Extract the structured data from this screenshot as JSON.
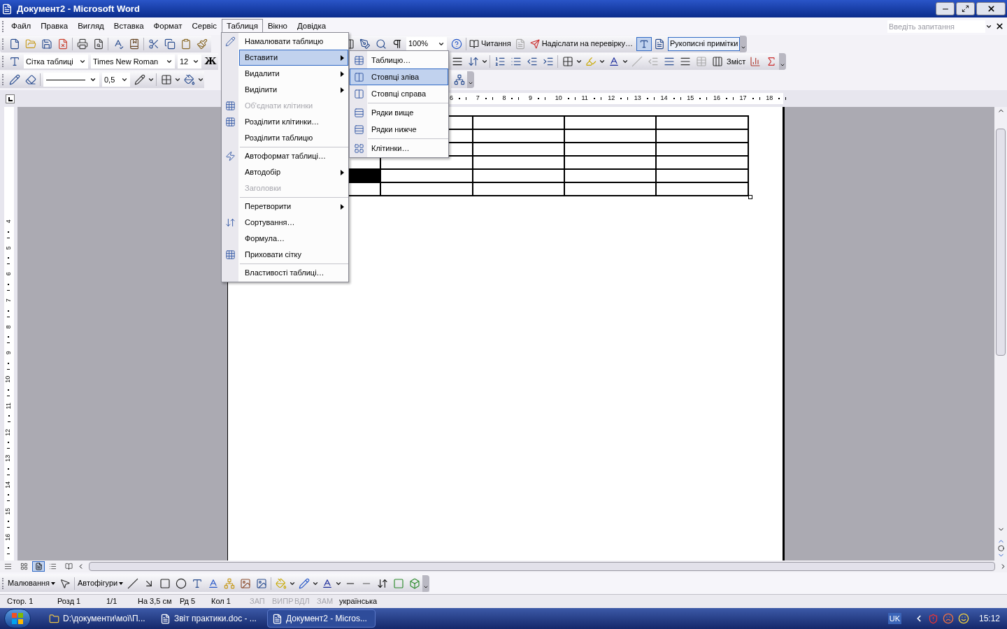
{
  "window": {
    "title": "Документ2 - Microsoft Word"
  },
  "menu_bar": [
    {
      "label": "Файл",
      "selected": false
    },
    {
      "label": "Правка",
      "selected": false
    },
    {
      "label": "Вигляд",
      "selected": false
    },
    {
      "label": "Вставка",
      "selected": false
    },
    {
      "label": "Формат",
      "selected": false
    },
    {
      "label": "Сервіс",
      "selected": false
    },
    {
      "label": "Таблиця",
      "selected": true
    },
    {
      "label": "Вікно",
      "selected": false
    },
    {
      "label": "Довідка",
      "selected": false
    }
  ],
  "help_search": {
    "placeholder": "Введіть запитання"
  },
  "standard_toolbar": {
    "zoom": "100%",
    "reading": "Читання",
    "send_review": "Надіслати на перевірку…",
    "ink_annotations": "Рукописні примітки"
  },
  "formatting_toolbar": {
    "style": "Сітка таблиці",
    "font": "Times New Roman",
    "size": "12",
    "bold": "Ж",
    "toc": "Зміст"
  },
  "tables_toolbar": {
    "line_weight": "0,5"
  },
  "horizontal_ruler": [
    "6",
    "7",
    "8",
    "9",
    "10",
    "11",
    "12",
    "13",
    "14",
    "15",
    "16",
    "17",
    "18"
  ],
  "vertical_ruler": [
    "4",
    "5",
    "6",
    "7",
    "8",
    "9",
    "10",
    "11",
    "12",
    "13",
    "14",
    "15",
    "16"
  ],
  "table": {
    "rows": [
      {
        "cells": [
          {
            "selected": false
          },
          {
            "selected": false
          },
          {
            "selected": false
          },
          {
            "selected": false
          }
        ]
      },
      {
        "cells": [
          {
            "selected": false
          },
          {
            "selected": false
          },
          {
            "selected": false
          },
          {
            "selected": false
          }
        ]
      },
      {
        "cells": [
          {
            "selected": false
          },
          {
            "selected": false
          },
          {
            "selected": false
          },
          {
            "selected": false
          }
        ]
      },
      {
        "cells": [
          {
            "selected": false
          },
          {
            "selected": false
          },
          {
            "selected": false
          },
          {
            "selected": false
          },
          {
            "selected": false
          }
        ]
      },
      {
        "cells": [
          {
            "selected": true
          },
          {
            "selected": false
          },
          {
            "selected": false
          },
          {
            "selected": false
          },
          {
            "selected": false
          }
        ]
      },
      {
        "cells": [
          {
            "selected": false
          },
          {
            "selected": false
          },
          {
            "selected": false
          },
          {
            "selected": false
          },
          {
            "selected": false
          }
        ]
      }
    ]
  },
  "table_menu": [
    {
      "label": "Намалювати таблицю",
      "kind": "pencil",
      "disabled": false,
      "submenu": false,
      "selected": false,
      "separator_before": false
    },
    {
      "label": "Вставити",
      "kind": "none",
      "disabled": false,
      "submenu": true,
      "selected": true,
      "separator_before": false
    },
    {
      "label": "Видалити",
      "kind": "none",
      "disabled": false,
      "submenu": true,
      "selected": false,
      "separator_before": false
    },
    {
      "label": "Виділити",
      "kind": "none",
      "disabled": false,
      "submenu": true,
      "selected": false,
      "separator_before": false
    },
    {
      "label": "Об'єднати клітинки",
      "kind": "grid",
      "disabled": true,
      "submenu": false,
      "selected": false,
      "separator_before": false
    },
    {
      "label": "Розділити клітинки…",
      "kind": "grid",
      "disabled": false,
      "submenu": false,
      "selected": false,
      "separator_before": false
    },
    {
      "label": "Розділити таблицю",
      "kind": "none",
      "disabled": false,
      "submenu": false,
      "selected": false,
      "separator_before": false
    },
    {
      "label": "Автоформат таблиці…",
      "kind": "autoformat",
      "disabled": false,
      "submenu": false,
      "selected": false,
      "separator_before": true
    },
    {
      "label": "Автодобір",
      "kind": "none",
      "disabled": false,
      "submenu": true,
      "selected": false,
      "separator_before": false
    },
    {
      "label": "Заголовки",
      "kind": "none",
      "disabled": true,
      "submenu": false,
      "selected": false,
      "separator_before": false
    },
    {
      "label": "Перетворити",
      "kind": "none",
      "disabled": false,
      "submenu": true,
      "selected": false,
      "separator_before": true
    },
    {
      "label": "Сортування…",
      "kind": "sort",
      "disabled": false,
      "submenu": false,
      "selected": false,
      "separator_before": false
    },
    {
      "label": "Формула…",
      "kind": "none",
      "disabled": false,
      "submenu": false,
      "selected": false,
      "separator_before": false
    },
    {
      "label": "Приховати сітку",
      "kind": "grid",
      "disabled": false,
      "submenu": false,
      "selected": false,
      "separator_before": false
    },
    {
      "label": "Властивості таблиці…",
      "kind": "none",
      "disabled": false,
      "submenu": false,
      "selected": false,
      "separator_before": true
    }
  ],
  "insert_submenu": [
    {
      "label": "Таблицю…",
      "kind": "table",
      "selected": false,
      "separator_before": false
    },
    {
      "label": "Стовпці зліва",
      "kind": "columns",
      "selected": true,
      "separator_before": false
    },
    {
      "label": "Стовпці справа",
      "kind": "columns",
      "selected": false,
      "separator_before": false
    },
    {
      "label": "Рядки вище",
      "kind": "rows",
      "selected": false,
      "separator_before": true
    },
    {
      "label": "Рядки нижче",
      "kind": "rows",
      "selected": false,
      "separator_before": false
    },
    {
      "label": "Клітинки…",
      "kind": "cells",
      "selected": false,
      "separator_before": true
    }
  ],
  "drawing_toolbar": {
    "draw": "Малювання",
    "autoshapes": "Автофігури"
  },
  "status_bar": [
    {
      "text": "Стор. 1",
      "disabled": false
    },
    {
      "text": "Розд 1",
      "disabled": false
    },
    {
      "text": "1/1",
      "disabled": false
    },
    {
      "text": "На 3,5 см",
      "disabled": false
    },
    {
      "text": "Рд 5",
      "disabled": false
    },
    {
      "text": "Кол 1",
      "disabled": false
    },
    {
      "text": "ЗАП",
      "disabled": true
    },
    {
      "text": "ВИПР",
      "disabled": true
    },
    {
      "text": "ВДЛ",
      "disabled": true
    },
    {
      "text": "ЗАМ",
      "disabled": true
    },
    {
      "text": "українська",
      "disabled": false
    }
  ],
  "taskbar": {
    "tasks": [
      {
        "label": "D:\\документи\\мої\\П...",
        "kind": "folder",
        "selected": false
      },
      {
        "label": "Звіт практики.doc - ...",
        "kind": "word",
        "selected": false
      },
      {
        "label": "Документ2 - Micros...",
        "kind": "word",
        "selected": true
      }
    ],
    "language": "UK",
    "clock": "15:12"
  }
}
